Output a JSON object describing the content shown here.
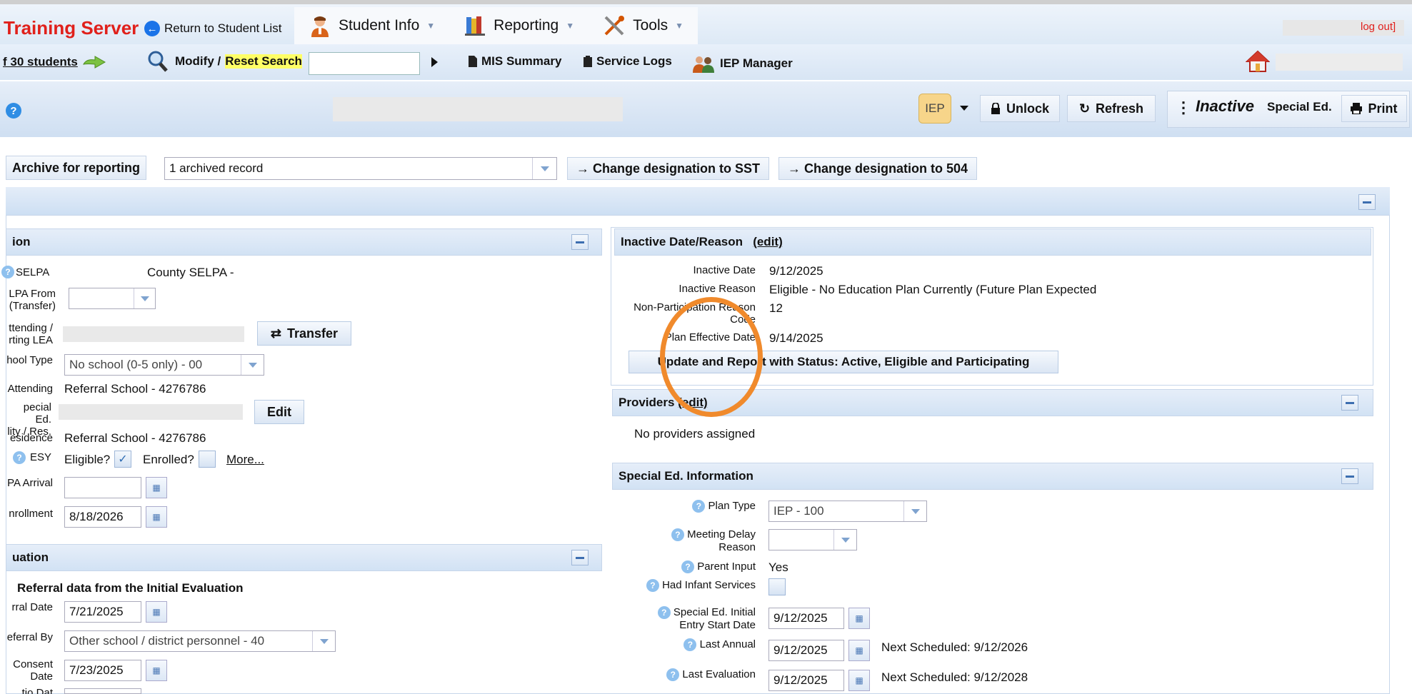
{
  "header": {
    "server_title": "Training Server",
    "return_label": "Return to Student List",
    "menu": [
      {
        "label": "Student Info"
      },
      {
        "label": "Reporting"
      },
      {
        "label": "Tools"
      }
    ],
    "logout": "log out]"
  },
  "toolbar": {
    "students_count": "f 30 students",
    "modify": "Modify /",
    "reset_search": "Reset Search",
    "search_value": "",
    "mis_summary": "MIS Summary",
    "service_logs": "Service Logs",
    "iep_manager": "IEP Manager"
  },
  "student_bar": {
    "iep_badge": "IEP",
    "unlock": "Unlock",
    "refresh": "Refresh",
    "status": "Inactive",
    "program": "Special Ed.",
    "print": "Print"
  },
  "archive": {
    "button": "Archive for reporting",
    "select_value": "1 archived record",
    "to_sst": "Change designation to SST",
    "to_504": "Change designation to 504"
  },
  "left_section": {
    "title": "ion",
    "fields": {
      "selpa_label": "SELPA",
      "selpa_value": "County SELPA -",
      "selpa_from_label_1": "LPA From",
      "selpa_from_label_2": "(Transfer)",
      "attending_label_1": "ttending /",
      "attending_label_2": "rting LEA",
      "transfer_btn": "Transfer",
      "school_type_label": "hool Type",
      "school_type_value": "No school (0-5 only) - 00",
      "attending_school_label": "Attending",
      "attending_school_value": "Referral School - 4276786",
      "sped_label_1": "pecial Ed.",
      "sped_label_2": "lity / Res.",
      "edit_btn": "Edit",
      "residence_label": "esidence",
      "residence_value": "Referral School - 4276786",
      "esy_label": "ESY",
      "eligible_label": "Eligible?",
      "enrolled_label": "Enrolled?",
      "more_link": "More...",
      "arrival_label": "PA Arrival",
      "arrival_value": "",
      "enrollment_label": "nrollment",
      "enrollment_value": "8/18/2026"
    }
  },
  "evaluation_section": {
    "title": "uation",
    "subtitle": "Referral data from the Initial Evaluation",
    "referral_date_label": "rral Date",
    "referral_date_value": "7/21/2025",
    "referral_by_label": "eferral By",
    "referral_by_value": "Other school / district personnel - 40",
    "consent_label_1": "Consent",
    "consent_label_2": "Date",
    "consent_value": "7/23/2025",
    "cut_label": "tio Dat"
  },
  "inactive_section": {
    "title": "Inactive Date/Reason",
    "edit": "(edit)",
    "inactive_date_label": "Inactive Date",
    "inactive_date_value": "9/12/2025",
    "inactive_reason_label": "Inactive Reason",
    "inactive_reason_value": "Eligible - No Education Plan Currently (Future Plan Expected",
    "nonpart_label_1": "Non-Participation Reason",
    "nonpart_label_2": "Code",
    "nonpart_value": "12",
    "plan_effective_label": "Plan Effective Date",
    "plan_effective_value": "9/14/2025",
    "update_btn": "Update and Report with Status: Active, Eligible and Participating"
  },
  "providers_section": {
    "title": "Providers",
    "edit": "(edit)",
    "empty": "No providers assigned"
  },
  "sped_section": {
    "title": "Special Ed. Information",
    "plan_type_label": "Plan Type",
    "plan_type_value": "IEP - 100",
    "meeting_delay_label_1": "Meeting Delay",
    "meeting_delay_label_2": "Reason",
    "meeting_delay_value": "",
    "parent_input_label": "Parent Input",
    "parent_input_value": "Yes",
    "infant_label": "Had Infant Services",
    "initial_entry_label_1": "Special Ed. Initial",
    "initial_entry_label_2": "Entry Start Date",
    "initial_entry_value": "9/12/2025",
    "last_annual_label": "Last Annual",
    "last_annual_value": "9/12/2025",
    "next_annual": "Next Scheduled: 9/12/2026",
    "last_eval_label": "Last Evaluation",
    "last_eval_value": "9/12/2025",
    "next_eval": "Next Scheduled: 9/12/2028"
  }
}
